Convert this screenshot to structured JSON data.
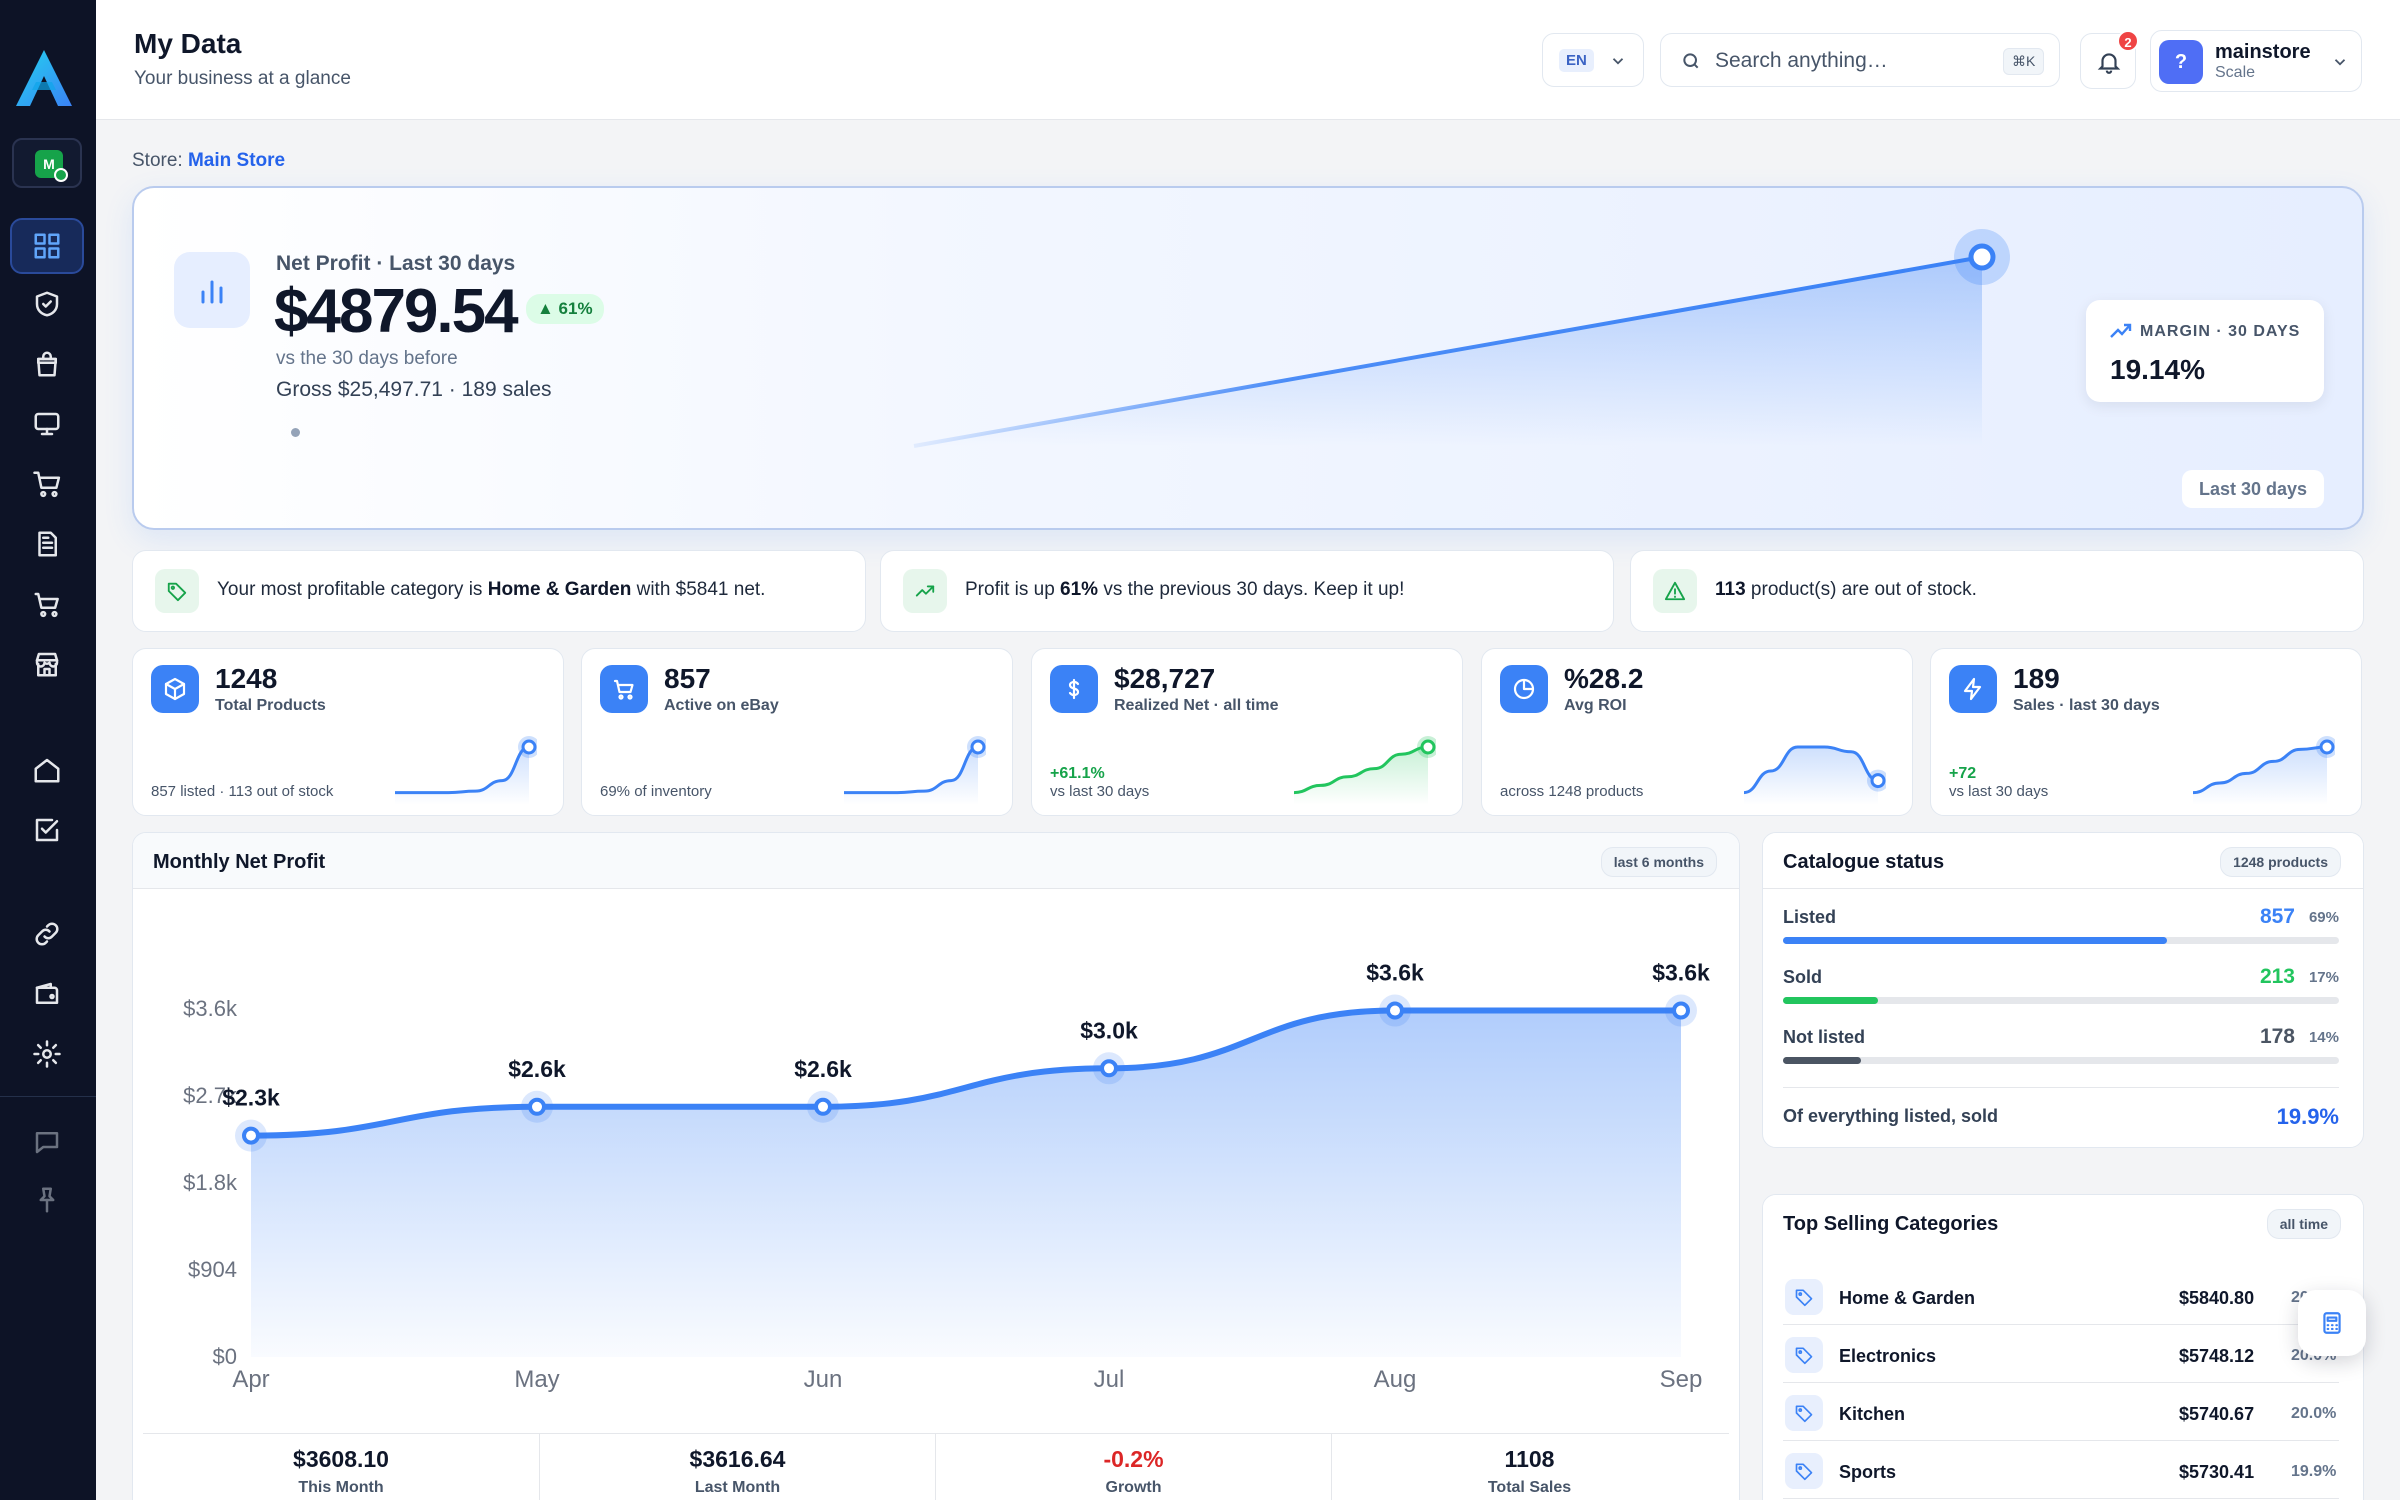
{
  "header": {
    "title": "My Data",
    "subtitle": "Your business at a glance",
    "lang_code": "EN",
    "search_placeholder": "Search anything…",
    "search_shortcut": "⌘K",
    "notification_count": "2",
    "user_avatar": "?",
    "user_name": "mainstore",
    "user_plan": "Scale"
  },
  "sidebar": {
    "store_initial": "M",
    "items": [
      {
        "icon": "dashboard-grid-icon",
        "active": true
      },
      {
        "icon": "shield-check-icon"
      },
      {
        "icon": "shopping-bag-icon"
      },
      {
        "icon": "monitor-icon"
      },
      {
        "icon": "shopping-cart-icon"
      },
      {
        "icon": "document-icon"
      },
      {
        "icon": "cart-icon"
      },
      {
        "icon": "storefront-icon"
      },
      {
        "icon": "home-icon"
      },
      {
        "icon": "checkbox-icon"
      },
      {
        "icon": "link-icon"
      },
      {
        "icon": "wallet-icon"
      },
      {
        "icon": "settings-icon"
      },
      {
        "icon": "chat-icon"
      },
      {
        "icon": "pin-icon"
      }
    ]
  },
  "store": {
    "label": "Store:",
    "name": "Main Store"
  },
  "hero": {
    "label": "Net Profit · Last 30 days",
    "value": "$4879.54",
    "change": "▲ 61%",
    "comparison": "vs the 30 days before",
    "gross": "Gross $25,497.71 · 189 sales",
    "margin_label": "MARGIN · 30 DAYS",
    "margin_value": "19.14%",
    "period_button": "Last 30 days",
    "accent": "#3b82f6"
  },
  "insights": [
    {
      "pre": "Your most profitable category is ",
      "bold": "Home & Garden",
      "post": " with $5841 net.",
      "icon": "tag-icon",
      "color": "#16a34a",
      "bg": "#e7f6ec"
    },
    {
      "pre": "Profit is up ",
      "bold": "61%",
      "post": " vs the previous 30 days. Keep it up!",
      "icon": "trending-up-icon",
      "color": "#16a34a",
      "bg": "#e7f6ec"
    },
    {
      "pre": "",
      "bold": "113",
      "post": " product(s) are out of stock.",
      "icon": "warning-icon",
      "color": "#16a34a",
      "bg": "#e7f6ec"
    }
  ],
  "kpis": [
    {
      "value": "1248",
      "label": "Total Products",
      "delta": "",
      "foot": "857 listed · 113 out of stock",
      "icon": "box-icon",
      "trend": [
        0.05,
        0.05,
        0.05,
        0.08,
        0.3,
        1.0
      ],
      "color": "#3b82f6"
    },
    {
      "value": "857",
      "label": "Active on eBay",
      "delta": "",
      "foot": "69% of inventory",
      "icon": "cart-icon",
      "trend": [
        0.05,
        0.05,
        0.05,
        0.08,
        0.3,
        1.0
      ],
      "color": "#3b82f6"
    },
    {
      "value": "$28,727",
      "label": "Realized Net · all time",
      "delta": "+61.1%",
      "foot": "vs last 30 days",
      "icon": "dollar-icon",
      "trend": [
        0.05,
        0.2,
        0.38,
        0.55,
        0.85,
        1.0
      ],
      "color": "#22c55e"
    },
    {
      "value": "%28.2",
      "label": "Avg ROI",
      "delta": "",
      "foot": "across 1248 products",
      "icon": "pie-chart-icon",
      "trend": [
        0.05,
        0.5,
        1.0,
        1.0,
        0.9,
        0.3
      ],
      "color": "#3b82f6"
    },
    {
      "value": "189",
      "label": "Sales · last 30 days",
      "delta": "+72",
      "foot": "vs last 30 days",
      "icon": "bolt-icon",
      "trend": [
        0.05,
        0.25,
        0.45,
        0.7,
        0.95,
        1.0
      ],
      "color": "#3b82f6"
    }
  ],
  "monthly": {
    "title": "Monthly Net Profit",
    "badge": "last 6 months",
    "stats": [
      {
        "value": "$3608.10",
        "label": "This Month",
        "color": "#0f172a"
      },
      {
        "value": "$3616.64",
        "label": "Last Month",
        "color": "#0f172a"
      },
      {
        "value": "-0.2%",
        "label": "Growth",
        "color": "#dc2626"
      },
      {
        "value": "1108",
        "label": "Total Sales",
        "color": "#0f172a"
      }
    ]
  },
  "chart_data": {
    "type": "area",
    "title": "Monthly Net Profit",
    "categories": [
      "Apr",
      "May",
      "Jun",
      "Jul",
      "Aug",
      "Sep"
    ],
    "values": [
      2300,
      2600,
      2600,
      3000,
      3600,
      3600
    ],
    "data_labels": [
      "$2.3k",
      "$2.6k",
      "$2.6k",
      "$3.0k",
      "$3.6k",
      "$3.6k"
    ],
    "y_ticks": [
      "$0",
      "$904",
      "$1.8k",
      "$2.7k",
      "$3.6k"
    ],
    "y_tick_values": [
      0,
      904,
      1808,
      2712,
      3616
    ],
    "ylim": [
      0,
      3616
    ],
    "grid": false,
    "color": "#3b82f6"
  },
  "catalogue": {
    "title": "Catalogue status",
    "badge": "1248 products",
    "rows": [
      {
        "label": "Listed",
        "value": "857",
        "pct": "69%",
        "fraction": 0.69,
        "color": "#3b82f6"
      },
      {
        "label": "Sold",
        "value": "213",
        "pct": "17%",
        "fraction": 0.17,
        "color": "#22c55e"
      },
      {
        "label": "Not listed",
        "value": "178",
        "pct": "14%",
        "fraction": 0.14,
        "color": "#4b5563"
      }
    ],
    "footer_label": "Of everything listed, sold",
    "footer_value": "19.9%"
  },
  "top_categories": {
    "title": "Top Selling Categories",
    "badge": "all time",
    "items": [
      {
        "name": "Home & Garden",
        "value": "$5840.80",
        "pct": "20.3%"
      },
      {
        "name": "Electronics",
        "value": "$5748.12",
        "pct": "20.0%"
      },
      {
        "name": "Kitchen",
        "value": "$5740.67",
        "pct": "20.0%"
      },
      {
        "name": "Sports",
        "value": "$5730.41",
        "pct": "19.9%"
      }
    ]
  }
}
